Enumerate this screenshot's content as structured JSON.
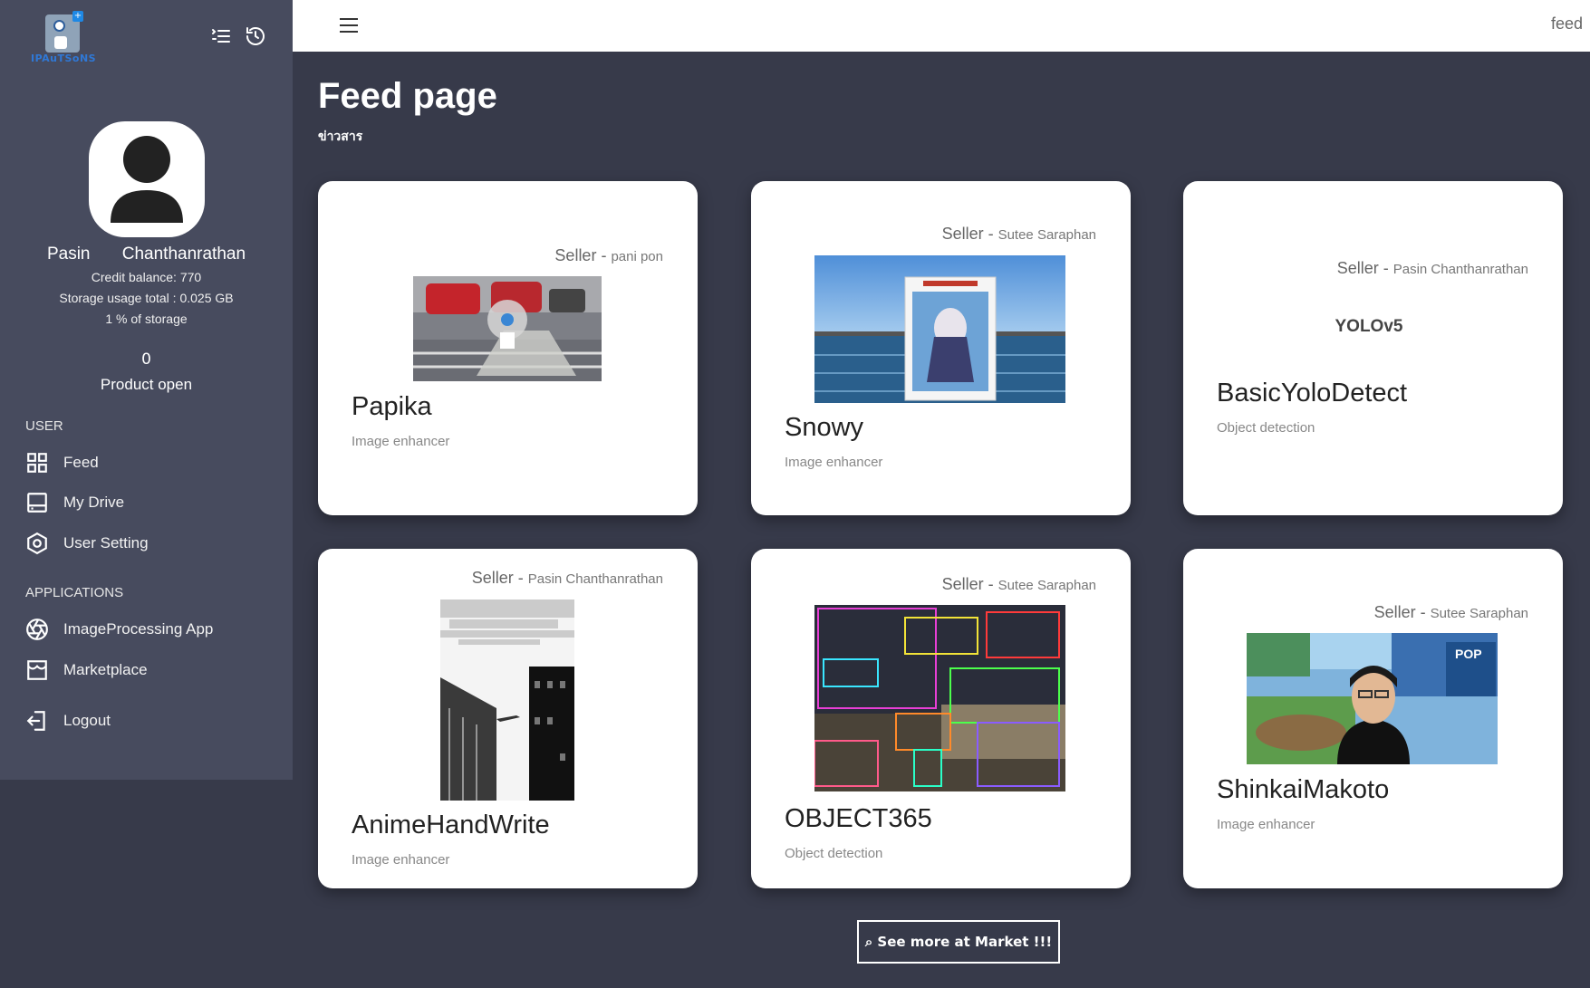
{
  "sidebar": {
    "logo_text": "IPAuTSoNS",
    "user": {
      "name": "Pasin Chanthanrathan",
      "credit": "Credit balance: 770",
      "storage": "Storage usage total : 0.025 GB",
      "storage_percent": "1 % of storage",
      "product_count": "0",
      "product_label": "Product open"
    },
    "sections": {
      "user": "USER",
      "applications": "APPLICATIONS"
    },
    "items": {
      "feed": "Feed",
      "drive": "My Drive",
      "setting": "User Setting",
      "imgproc": "ImageProcessing App",
      "market": "Marketplace",
      "logout": "Logout"
    }
  },
  "topbar": {
    "right_label": "feed"
  },
  "page": {
    "title": "Feed page",
    "subtitle": "ข่าวสาร"
  },
  "seller_prefix": "Seller - ",
  "cards": [
    {
      "title": "Papika",
      "category": "Image enhancer",
      "seller": "pani pon"
    },
    {
      "title": "Snowy",
      "category": "Image enhancer",
      "seller": "Sutee Saraphan"
    },
    {
      "title": "BasicYoloDetect",
      "category": "Object detection",
      "seller": "Pasin Chanthanrathan",
      "logo_text": "YOLOv5"
    },
    {
      "title": "AnimeHandWrite",
      "category": "Image enhancer",
      "seller": "Pasin Chanthanrathan"
    },
    {
      "title": "OBJECT365",
      "category": "Object detection",
      "seller": "Sutee Saraphan"
    },
    {
      "title": "ShinkaiMakoto",
      "category": "Image enhancer",
      "seller": "Sutee Saraphan",
      "thumb_text": "POP"
    }
  ],
  "more_button": "⌕ See more at Market !!!",
  "colors": {
    "background": "#373a4a",
    "sidebar": "#474b5e",
    "card": "#ffffff"
  }
}
